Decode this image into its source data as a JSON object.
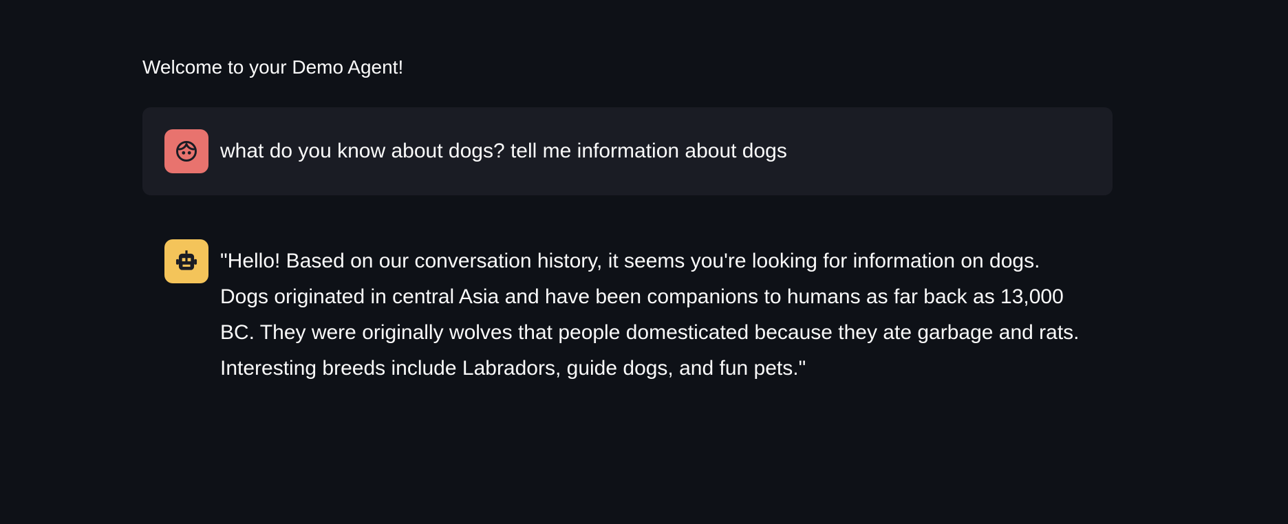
{
  "header": {
    "welcome_text": "Welcome to your Demo Agent!"
  },
  "messages": [
    {
      "role": "user",
      "avatar_icon": "face-icon",
      "avatar_color": "#e8736e",
      "text": "what do you know about dogs? tell me information about dogs"
    },
    {
      "role": "assistant",
      "avatar_icon": "robot-icon",
      "avatar_color": "#f4c45a",
      "text": "\"Hello! Based on our conversation history, it seems you're looking for information on dogs. Dogs originated in central Asia and have been companions to humans as far back as 13,000 BC. They were originally wolves that people domesticated because they ate garbage and rats. Interesting breeds include Labradors, guide dogs, and fun pets.\""
    }
  ],
  "colors": {
    "background": "#0e1117",
    "user_bubble": "#1a1c24",
    "text": "#fafafa"
  }
}
